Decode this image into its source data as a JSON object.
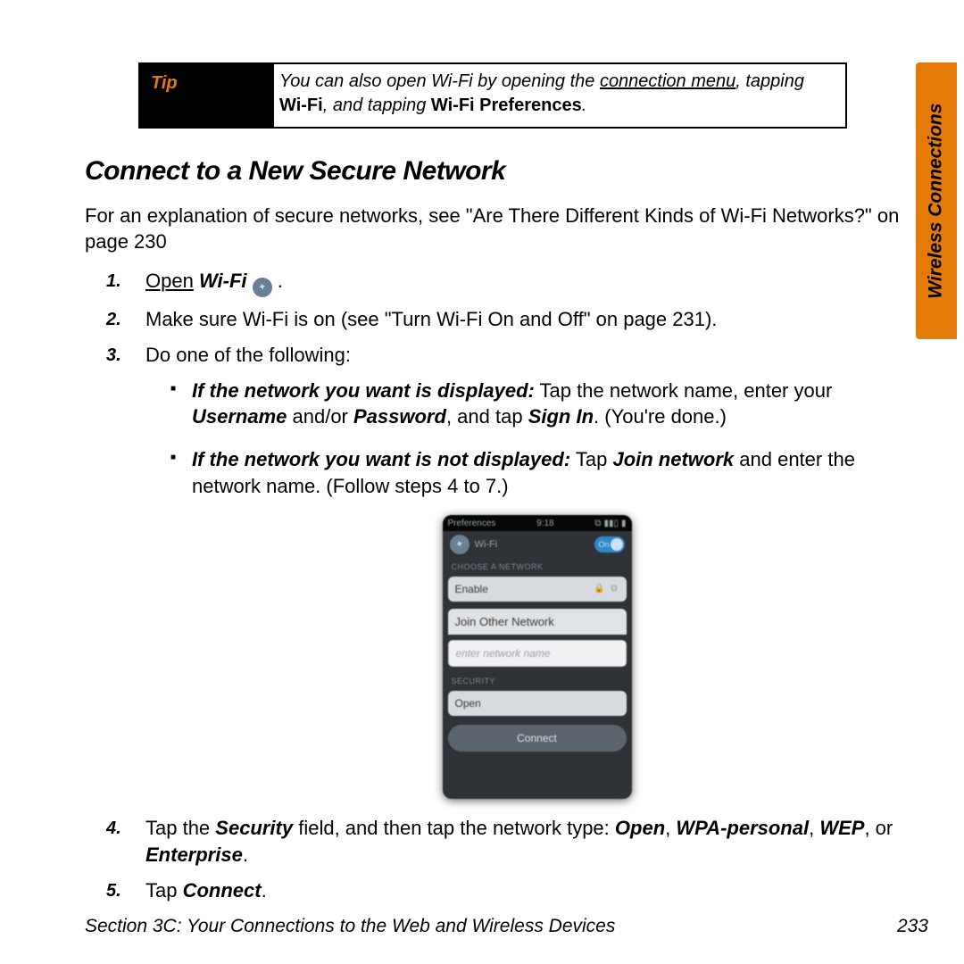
{
  "side_tab": "Wireless Connections",
  "tip": {
    "label": "Tip",
    "prefix": "You can also open Wi-Fi by opening the ",
    "link": "connection menu",
    "mid": ", tapping ",
    "bold1": "Wi-Fi",
    "mid2": ", and tapping ",
    "bold2": "Wi-Fi Preferences",
    "suffix": "."
  },
  "heading": "Connect to a New Secure Network",
  "intro": "For an explanation of secure networks, see \"Are There Different Kinds of Wi-Fi Networks?\" on page 230",
  "steps": {
    "s1": {
      "open": "Open",
      "wifi": "Wi-Fi",
      "dot": " ."
    },
    "s2": "Make sure Wi-Fi is on (see \"Turn Wi-Fi On and Off\" on page 231).",
    "s3": "Do one of the following:",
    "s3a": {
      "lead": "If the network you want is displayed:",
      "rest_a": " Tap the network name, enter your ",
      "user": "Username",
      "rest_b": " and/or ",
      "pass": "Password",
      "rest_c": ", and tap ",
      "signin": "Sign In",
      "rest_d": ". (You're done.)"
    },
    "s3b": {
      "lead": "If the network you want is not displayed:",
      "rest_a": " Tap ",
      "join": "Join network",
      "rest_b": " and enter the network name. (Follow steps 4 to 7.)"
    },
    "s4": {
      "a": "Tap the ",
      "sec": "Security",
      "b": " field, and then tap the network type: ",
      "t1": "Open",
      "c1": ", ",
      "t2": "WPA-personal",
      "c2": ", ",
      "t3": "WEP",
      "c3": ", or ",
      "t4": "Enterprise",
      "d": "."
    },
    "s5": {
      "a": "Tap ",
      "connect": "Connect",
      "b": "."
    }
  },
  "phone": {
    "status_left": "Preferences",
    "status_time": "9:18",
    "title": "Wi-Fi",
    "toggle": "On",
    "choose": "CHOOSE A NETWORK",
    "net1": "Enable",
    "join_header": "Join Other Network",
    "placeholder": "enter network name",
    "security_label": "SECURITY",
    "security_value": "Open",
    "connect": "Connect"
  },
  "footer": {
    "left": "Section 3C: Your Connections to the Web and Wireless Devices",
    "page": "233"
  }
}
